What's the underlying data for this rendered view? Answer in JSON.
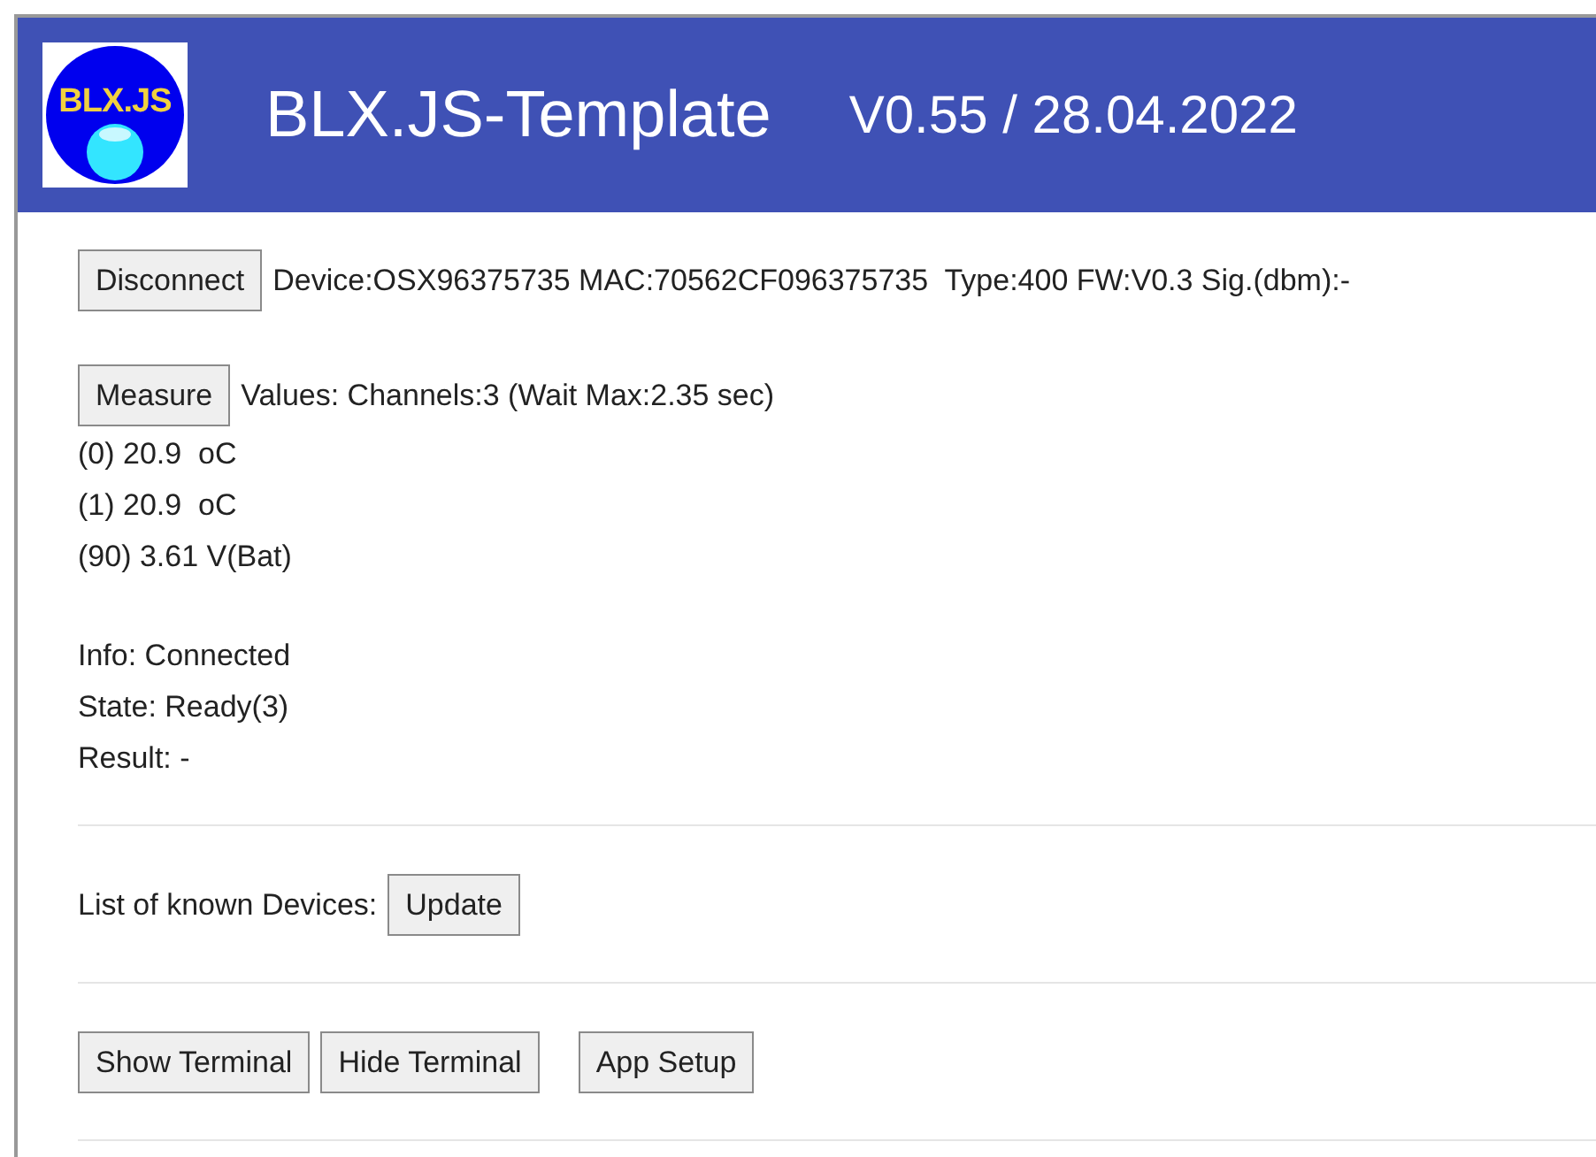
{
  "header": {
    "logo_text": "BLX.JS",
    "title": "BLX.JS-Template",
    "version": "V0.55 / 28.04.2022"
  },
  "connection": {
    "button": "Disconnect",
    "info": "Device:OSX96375735 MAC:70562CF096375735  Type:400 FW:V0.3 Sig.(dbm):-"
  },
  "measure": {
    "button": "Measure",
    "info": "Values: Channels:3 (Wait Max:2.35 sec)",
    "values": [
      "(0) 20.9  oC",
      "(1) 20.9  oC",
      "(90) 3.61 V(Bat)"
    ]
  },
  "status": [
    "Info: Connected",
    "State: Ready(3)",
    "Result: -"
  ],
  "devices": {
    "label": "List of known Devices:",
    "button": "Update"
  },
  "buttons": [
    "Show Terminal",
    "Hide Terminal",
    "App Setup"
  ]
}
